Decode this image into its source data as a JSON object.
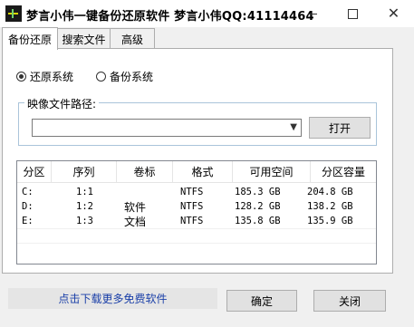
{
  "window": {
    "title": "梦言小伟一键备份还原软件  梦言小伟QQ:41114464",
    "min_icon": "minimize-icon",
    "max_icon": "maximize-icon",
    "close_glyph": "✕"
  },
  "tabs": [
    {
      "label": "备份还原",
      "active": true
    },
    {
      "label": "搜索文件",
      "active": false
    },
    {
      "label": "高级",
      "active": false
    }
  ],
  "mode": {
    "restore_label": "还原系统",
    "backup_label": "备份系统",
    "selected": "restore"
  },
  "image_path": {
    "group_label": "映像文件路径:",
    "value": "",
    "open_label": "打开"
  },
  "drives": {
    "columns": [
      "分区",
      "序列",
      "卷标",
      "格式",
      "可用空间",
      "分区容量"
    ],
    "rows": [
      [
        "C:",
        "1:1",
        "",
        "NTFS",
        "185.3 GB",
        "204.8 GB"
      ],
      [
        "D:",
        "1:2",
        "软件",
        "NTFS",
        "128.2 GB",
        "138.2 GB"
      ],
      [
        "E:",
        "1:3",
        "文档",
        "NTFS",
        "135.8 GB",
        "135.9 GB"
      ]
    ]
  },
  "footer": {
    "download_link": "点击下载更多免费软件",
    "ok_label": "确定",
    "close_label": "关闭"
  },
  "colors": {
    "link": "#1a3fa8",
    "group_border": "#aac4da"
  }
}
